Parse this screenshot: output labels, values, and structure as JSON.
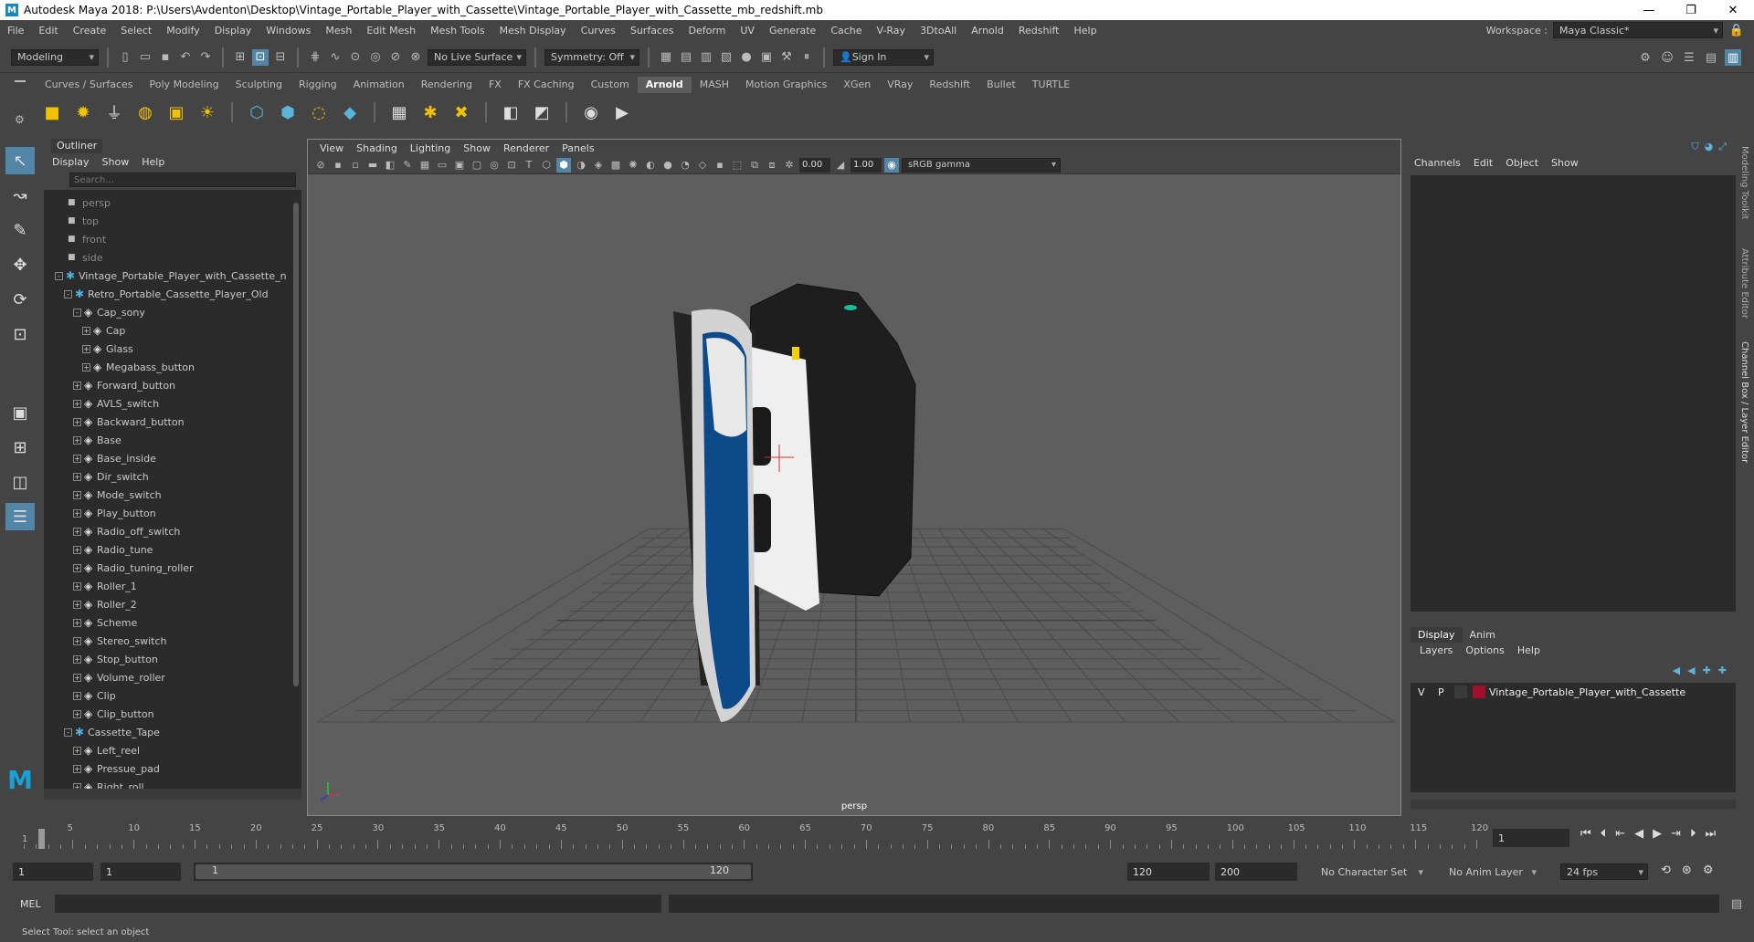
{
  "window": {
    "title": "Autodesk Maya 2018: P:\\Users\\Avdenton\\Desktop\\Vintage_Portable_Player_with_Cassette\\Vintage_Portable_Player_with_Cassette_mb_redshift.mb",
    "logo": "M",
    "minimize": "—",
    "maximize": "❐",
    "close": "✕"
  },
  "menubar": [
    "File",
    "Edit",
    "Create",
    "Select",
    "Modify",
    "Display",
    "Windows",
    "Mesh",
    "Edit Mesh",
    "Mesh Tools",
    "Mesh Display",
    "Curves",
    "Surfaces",
    "Deform",
    "UV",
    "Generate",
    "Cache",
    "V-Ray",
    "3DtoAll",
    "Arnold",
    "Redshift",
    "Help"
  ],
  "workspace": {
    "label": "Workspace :",
    "value": "Maya Classic*"
  },
  "status": {
    "mode": "Modeling",
    "live_surface": "No Live Surface",
    "symmetry": "Symmetry: Off",
    "sign_in": "Sign In"
  },
  "shelf_tabs": [
    "Curves / Surfaces",
    "Poly Modeling",
    "Sculpting",
    "Rigging",
    "Animation",
    "Rendering",
    "FX",
    "FX Caching",
    "Custom",
    "Arnold",
    "MASH",
    "Motion Graphics",
    "XGen",
    "VRay",
    "Redshift",
    "Bullet",
    "TURTLE"
  ],
  "shelf_active": "Arnold",
  "outliner": {
    "title": "Outliner",
    "menu": [
      "Display",
      "Show",
      "Help"
    ],
    "search_placeholder": "Search...",
    "items": [
      {
        "label": "persp",
        "type": "cam",
        "indent": 0
      },
      {
        "label": "top",
        "type": "cam",
        "indent": 0
      },
      {
        "label": "front",
        "type": "cam",
        "indent": 0
      },
      {
        "label": "side",
        "type": "cam",
        "indent": 0
      },
      {
        "label": "Vintage_Portable_Player_with_Cassette_n",
        "type": "group",
        "indent": 0,
        "exp": "-"
      },
      {
        "label": "Retro_Portable_Cassette_Player_Old",
        "type": "group",
        "indent": 1,
        "exp": "-"
      },
      {
        "label": "Cap_sony",
        "type": "mesh",
        "indent": 2,
        "exp": "-"
      },
      {
        "label": "Cap",
        "type": "mesh",
        "indent": 3,
        "exp": "+"
      },
      {
        "label": "Glass",
        "type": "mesh",
        "indent": 3,
        "exp": "+"
      },
      {
        "label": "Megabass_button",
        "type": "mesh",
        "indent": 3,
        "exp": "+"
      },
      {
        "label": "Forward_button",
        "type": "mesh",
        "indent": 2,
        "exp": "+"
      },
      {
        "label": "AVLS_switch",
        "type": "mesh",
        "indent": 2,
        "exp": "+"
      },
      {
        "label": "Backward_button",
        "type": "mesh",
        "indent": 2,
        "exp": "+"
      },
      {
        "label": "Base",
        "type": "mesh",
        "indent": 2,
        "exp": "+"
      },
      {
        "label": "Base_inside",
        "type": "mesh",
        "indent": 2,
        "exp": "+"
      },
      {
        "label": "Dir_switch",
        "type": "mesh",
        "indent": 2,
        "exp": "+"
      },
      {
        "label": "Mode_switch",
        "type": "mesh",
        "indent": 2,
        "exp": "+"
      },
      {
        "label": "Play_button",
        "type": "mesh",
        "indent": 2,
        "exp": "+"
      },
      {
        "label": "Radio_off_switch",
        "type": "mesh",
        "indent": 2,
        "exp": "+"
      },
      {
        "label": "Radio_tune",
        "type": "mesh",
        "indent": 2,
        "exp": "+"
      },
      {
        "label": "Radio_tuning_roller",
        "type": "mesh",
        "indent": 2,
        "exp": "+"
      },
      {
        "label": "Roller_1",
        "type": "mesh",
        "indent": 2,
        "exp": "+"
      },
      {
        "label": "Roller_2",
        "type": "mesh",
        "indent": 2,
        "exp": "+"
      },
      {
        "label": "Scheme",
        "type": "mesh",
        "indent": 2,
        "exp": "+"
      },
      {
        "label": "Stereo_switch",
        "type": "mesh",
        "indent": 2,
        "exp": "+"
      },
      {
        "label": "Stop_button",
        "type": "mesh",
        "indent": 2,
        "exp": "+"
      },
      {
        "label": "Volume_roller",
        "type": "mesh",
        "indent": 2,
        "exp": "+"
      },
      {
        "label": "Clip",
        "type": "mesh",
        "indent": 2,
        "exp": "+"
      },
      {
        "label": "Clip_button",
        "type": "mesh",
        "indent": 2,
        "exp": "+"
      },
      {
        "label": "Cassette_Tape",
        "type": "group",
        "indent": 1,
        "exp": "-"
      },
      {
        "label": "Left_reel",
        "type": "mesh",
        "indent": 2,
        "exp": "+"
      },
      {
        "label": "Pressue_pad",
        "type": "mesh",
        "indent": 2,
        "exp": "+"
      },
      {
        "label": "Right_roll",
        "type": "mesh",
        "indent": 2,
        "exp": "+"
      }
    ]
  },
  "viewport": {
    "menu": [
      "View",
      "Shading",
      "Lighting",
      "Show",
      "Renderer",
      "Panels"
    ],
    "exposure": "0.00",
    "gamma": "1.00",
    "color_space": "sRGB gamma",
    "camera": "persp"
  },
  "channelbox": {
    "menu": [
      "Channels",
      "Edit",
      "Object",
      "Show"
    ]
  },
  "layer_editor": {
    "tabs": [
      "Display",
      "Anim"
    ],
    "active_tab": "Display",
    "menu": [
      "Layers",
      "Options",
      "Help"
    ],
    "layer": {
      "v": "V",
      "p": "P",
      "name": "Vintage_Portable_Player_with_Cassette",
      "color": "#a0102a"
    }
  },
  "side_tabs": [
    "Modeling Toolkit",
    "Attribute Editor",
    "Channel Box / Layer Editor"
  ],
  "timeline": {
    "ticks": [
      "5",
      "10",
      "15",
      "20",
      "25",
      "30",
      "35",
      "40",
      "45",
      "50",
      "55",
      "60",
      "65",
      "70",
      "75",
      "80",
      "85",
      "90",
      "95",
      "100",
      "105",
      "110",
      "115",
      "120"
    ],
    "start_label": "1",
    "current_frame": "1"
  },
  "range": {
    "start": "1",
    "start2": "1",
    "range_start": "1",
    "range_end": "120",
    "end": "120",
    "anim_end": "200",
    "character_set": "No Character Set",
    "anim_layer": "No Anim Layer",
    "fps": "24 fps"
  },
  "command": {
    "label": "MEL"
  },
  "help_line": "Select Tool: select an object"
}
